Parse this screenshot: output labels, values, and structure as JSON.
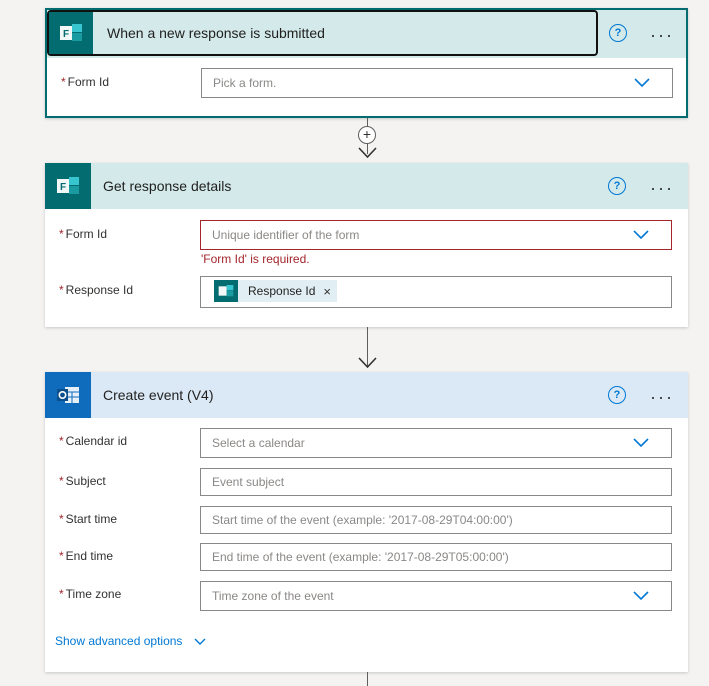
{
  "colors": {
    "forms_teal": "#036c70",
    "forms_header_bg": "#d3e9ea",
    "outlook_blue": "#0f6cbd",
    "outlook_header_bg": "#dbe9f6",
    "accent": "#0078d4",
    "error": "#a4262c"
  },
  "trigger": {
    "title": "When a new response is submitted",
    "app_icon": "microsoft-forms-icon",
    "fields": [
      {
        "label": "Form Id",
        "required_mark": "*",
        "placeholder": "Pick a form."
      }
    ]
  },
  "step_get_response": {
    "title": "Get response details",
    "app_icon": "microsoft-forms-icon",
    "fields": [
      {
        "label": "Form Id",
        "required_mark": "*",
        "placeholder": "Unique identifier of the form",
        "error": "'Form Id' is required."
      },
      {
        "label": "Response Id",
        "required_mark": "*",
        "token": {
          "label": "Response Id",
          "remove": "×"
        }
      }
    ]
  },
  "step_create_event": {
    "title": "Create event (V4)",
    "app_icon": "outlook-calendar-icon",
    "fields": [
      {
        "label": "Calendar id",
        "required_mark": "*",
        "placeholder": "Select a calendar"
      },
      {
        "label": "Subject",
        "required_mark": "*",
        "placeholder": "Event subject"
      },
      {
        "label": "Start time",
        "required_mark": "*",
        "placeholder": "Start time of the event (example: '2017-08-29T04:00:00')"
      },
      {
        "label": "End time",
        "required_mark": "*",
        "placeholder": "End time of the event (example: '2017-08-29T05:00:00')"
      },
      {
        "label": "Time zone",
        "required_mark": "*",
        "placeholder": "Time zone of the event"
      }
    ],
    "advanced_link": "Show advanced options"
  },
  "common": {
    "help_glyph": "?",
    "more_glyph": "···",
    "add_step_glyph": "+"
  }
}
